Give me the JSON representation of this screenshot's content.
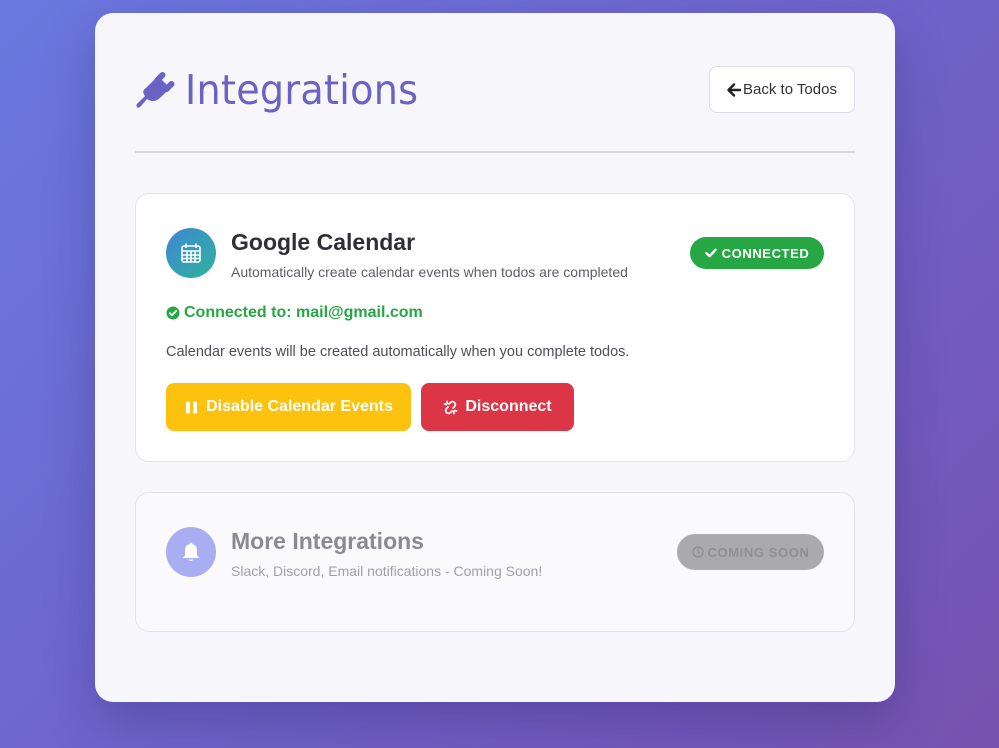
{
  "header": {
    "title": "Integrations",
    "title_icon": "plug-icon",
    "back_button_label": "Back to Todos",
    "back_button_icon": "arrow-left-icon"
  },
  "integrations": {
    "google_calendar": {
      "icon": "calendar-icon",
      "name": "Google Calendar",
      "description": "Automatically create calendar events when todos are completed",
      "status_label": "CONNECTED",
      "connected_to": "Connected to: mail@gmail.com",
      "info": "Calendar events will be created automatically when you complete todos.",
      "disable_button_label": "Disable Calendar Events",
      "disconnect_button_label": "Disconnect"
    },
    "more": {
      "icon": "bell-icon",
      "name": "More Integrations",
      "description": "Slack, Discord, Email notifications - Coming Soon!",
      "status_label": "COMING SOON"
    }
  },
  "colors": {
    "accent": "#6b63c4",
    "success": "#27a644",
    "warning": "#fdc20e",
    "danger": "#dc3546",
    "muted": "#a9a9ae"
  }
}
